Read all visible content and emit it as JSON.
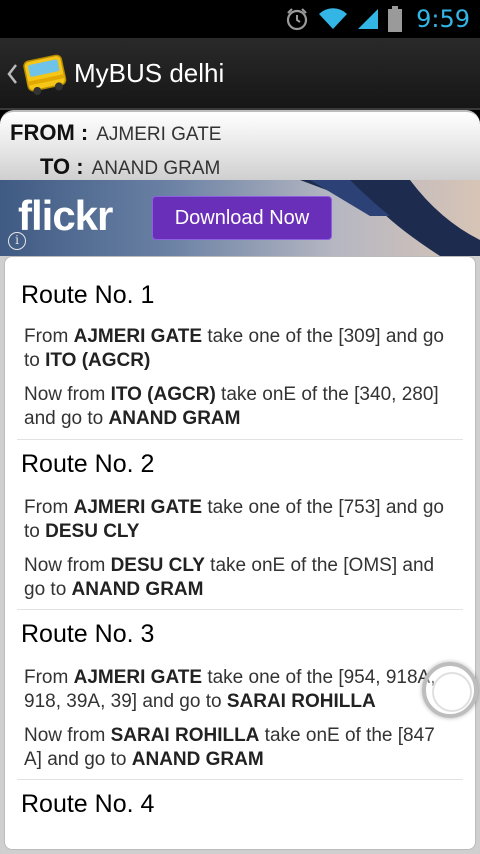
{
  "status_bar": {
    "time": "9:59",
    "icons": [
      "alarm-icon",
      "wifi-icon",
      "signal-icon",
      "battery-icon"
    ],
    "accent": "#33b5e5"
  },
  "action_bar": {
    "title": "MyBUS delhi",
    "logo": "bus-icon"
  },
  "journey": {
    "from_label": "FROM :",
    "from_value": "AJMERI GATE",
    "to_label": "TO :",
    "to_value": "ANAND GRAM"
  },
  "ad": {
    "brand": "flickr",
    "button": "Download Now",
    "info": "i"
  },
  "routes": [
    {
      "title": "Route No. 1",
      "steps": [
        [
          "From ",
          "AJMERI GATE",
          " take one of the [309] and go to ",
          "ITO (AGCR)",
          ""
        ],
        [
          "Now from ",
          "ITO (AGCR)",
          " take onE of the [340, 280] and go to ",
          "ANAND GRAM",
          ""
        ]
      ]
    },
    {
      "title": "Route No. 2",
      "steps": [
        [
          "From ",
          "AJMERI GATE",
          " take one of the [753] and go to ",
          "DESU CLY",
          ""
        ],
        [
          "Now from ",
          "DESU CLY",
          " take onE of the [OMS] and go to ",
          "ANAND GRAM",
          ""
        ]
      ]
    },
    {
      "title": "Route No. 3",
      "steps": [
        [
          "From ",
          "AJMERI GATE",
          " take one of the [954, 918A, 918, 39A, 39] and go to ",
          "SARAI ROHILLA",
          ""
        ],
        [
          "Now from ",
          "SARAI ROHILLA",
          " take onE of the [847 A] and go to ",
          "ANAND GRAM",
          ""
        ]
      ]
    },
    {
      "title": "Route No. 4",
      "steps": []
    }
  ]
}
